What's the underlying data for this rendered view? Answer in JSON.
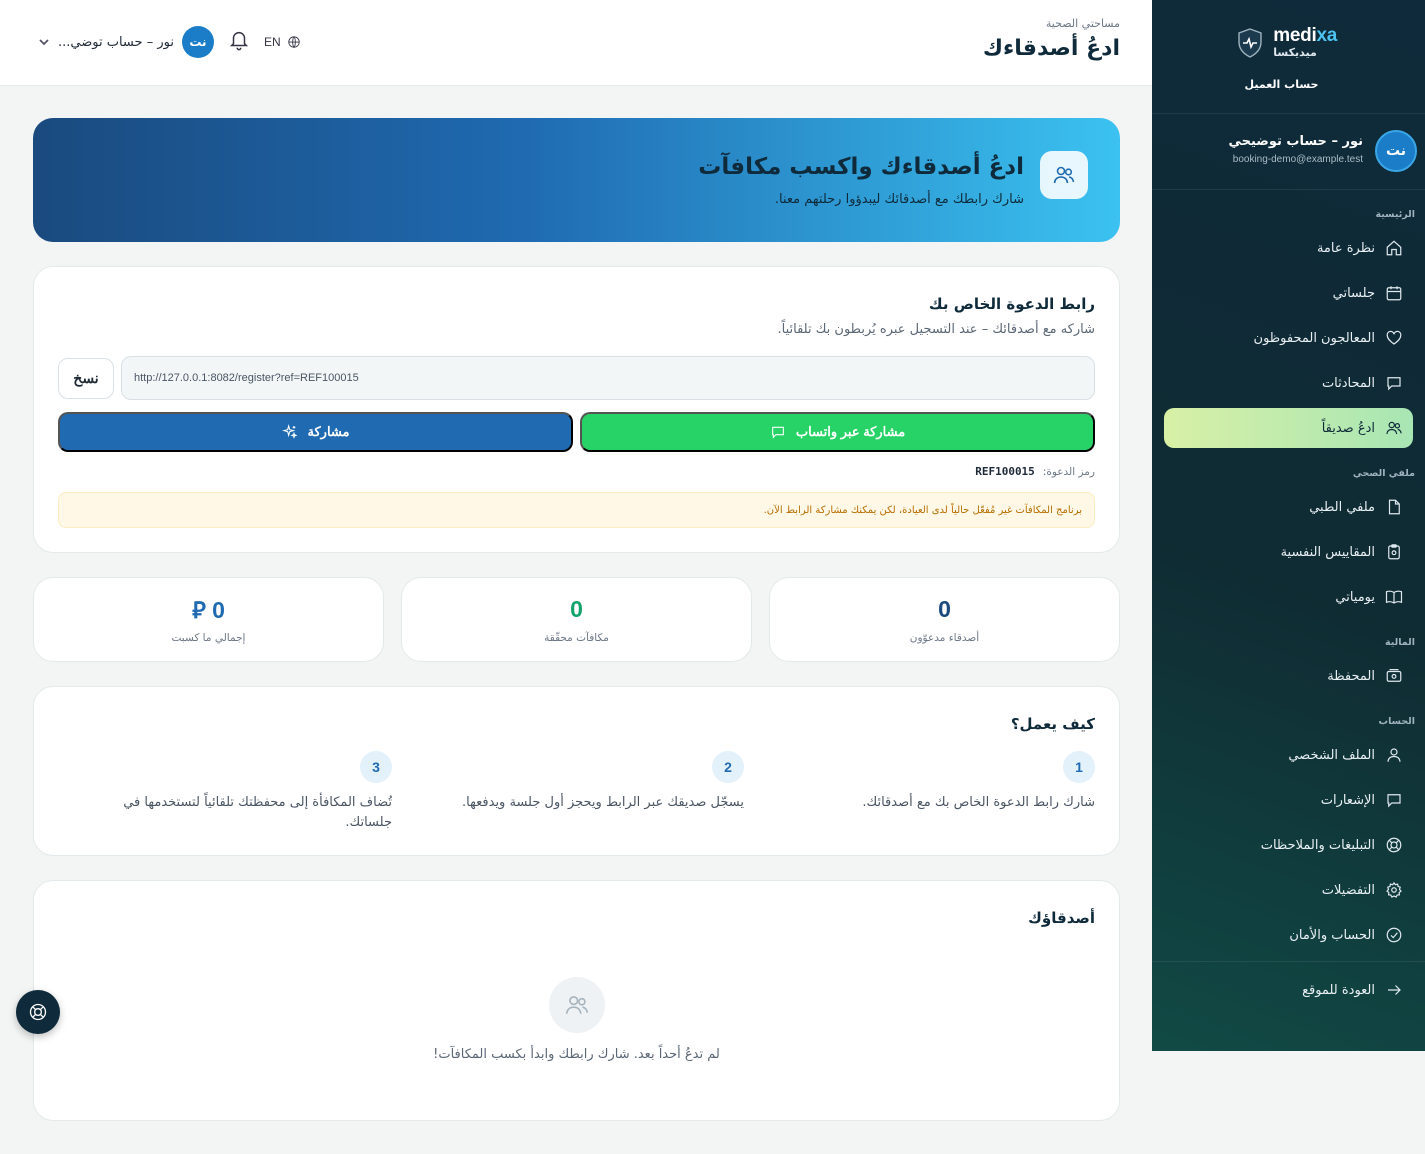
{
  "brand": {
    "name_prefix": "medi",
    "name_suffix": "xa",
    "name_ar": "ميديكسا",
    "account_type": "حساب العميل"
  },
  "user": {
    "initials": "نت",
    "name": "نور – حساب توضيحي",
    "email": "booking-demo@example.test",
    "short_name": "نور – حساب توضي..."
  },
  "sidebar": {
    "sections": {
      "main": "الرئيسية",
      "health": "ملفي الصحي",
      "finance": "المالية",
      "account": "الحساب"
    },
    "items": {
      "overview": "نظرة عامة",
      "sessions": "جلساتي",
      "saved_therapists": "المعالجون المحفوظون",
      "conversations": "المحادثات",
      "invite_friend": "ادعُ صديقاً",
      "medical_file": "ملفي الطبي",
      "psych_scales": "المقاييس النفسية",
      "journal": "يومياتي",
      "wallet": "المحفظة",
      "profile": "الملف الشخصي",
      "notifications": "الإشعارات",
      "reports": "التبليغات والملاحظات",
      "preferences": "التفضيلات",
      "security": "الحساب والأمان",
      "back_to_site": "العودة للموقع"
    }
  },
  "header": {
    "breadcrumb": "مساحتي الصحية",
    "title": "ادعُ أصدقاءك",
    "lang": "EN"
  },
  "hero": {
    "title": "ادعُ أصدقاءك واكسب مكافآت",
    "subtitle": "شارك رابطك مع أصدقائك ليبدؤوا رحلتهم معنا."
  },
  "invite": {
    "title": "رابط الدعوة الخاص بك",
    "subtitle": "شاركه مع أصدقائك – عند التسجيل عبره يُربطون بك تلقائياً.",
    "link": "http://127.0.0.1:8082/register?ref=REF100015",
    "copy_label": "نسخ",
    "whatsapp_label": "مشاركة عبر واتساب",
    "share_label": "مشاركة",
    "code_label": "رمز الدعوة:",
    "code_value": "REF100015",
    "notice": "برنامج المكافآت غير مُفعّل حالياً لدى العيادة، لكن يمكنك مشاركة الرابط الآن."
  },
  "stats": [
    {
      "value": "0",
      "label": "أصدقاء مدعوّون"
    },
    {
      "value": "0",
      "label": "مكافآت محقّقة"
    },
    {
      "value": "0 ⃁",
      "label": "إجمالي ما كسبت"
    }
  ],
  "how": {
    "title": "كيف يعمل؟",
    "steps": [
      {
        "num": "1",
        "text": "شارك رابط الدعوة الخاص بك مع أصدقائك."
      },
      {
        "num": "2",
        "text": "يسجّل صديقك عبر الرابط ويحجز أول جلسة ويدفعها."
      },
      {
        "num": "3",
        "text": "تُضاف المكافأة إلى محفظتك تلقائياً لتستخدمها في جلساتك."
      }
    ]
  },
  "friends": {
    "title": "أصدقاؤك",
    "empty": "لم تدعُ أحداً بعد. شارك رابطك وابدأ بكسب المكافآت!"
  },
  "colors": {
    "accent": "#1f6ab1",
    "whatsapp": "#27d366",
    "sidebar": "#0f2a3a",
    "active": "#a8e6b4"
  }
}
